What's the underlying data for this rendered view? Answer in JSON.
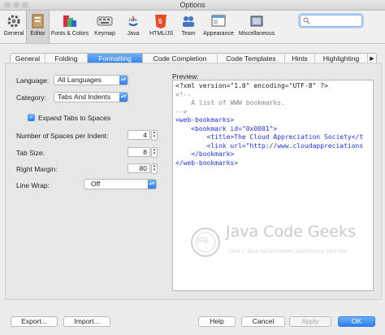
{
  "window": {
    "title": "Options"
  },
  "toolbar": {
    "items": [
      {
        "label": "General",
        "icon": "gear-icon"
      },
      {
        "label": "Editor",
        "icon": "editor-icon"
      },
      {
        "label": "Fonts & Colors",
        "icon": "fonts-colors-icon"
      },
      {
        "label": "Keymap",
        "icon": "keymap-icon"
      },
      {
        "label": "Java",
        "icon": "java-icon"
      },
      {
        "label": "HTML/JS",
        "icon": "html5-icon"
      },
      {
        "label": "Team",
        "icon": "team-icon"
      },
      {
        "label": "Appearance",
        "icon": "appearance-icon"
      },
      {
        "label": "Miscellaneous",
        "icon": "miscellaneous-icon"
      }
    ],
    "selected": "Editor",
    "search": {
      "value": "",
      "placeholder": ""
    }
  },
  "tabs": {
    "items": [
      "General",
      "Folding",
      "Formatting",
      "Code Completion",
      "Code Templates",
      "Hints",
      "Highlighting"
    ],
    "selected": "Formatting"
  },
  "form": {
    "language_label": "Language:",
    "language_value": "All Languages",
    "category_label": "Category:",
    "category_value": "Tabs And Indents",
    "expand_tabs_label": "Expand Tabs to Spaces",
    "expand_tabs_checked": true,
    "spaces_label": "Number of Spaces per Indent:",
    "spaces_value": "4",
    "tab_size_label": "Tab Size:",
    "tab_size_value": "8",
    "right_margin_label": "Right Margin:",
    "right_margin_value": "80",
    "line_wrap_label": "Line Wrap:",
    "line_wrap_value": "Off"
  },
  "preview": {
    "label": "Preview:",
    "lines": [
      "<?xml version=\"1.0\" encoding=\"UTF-8\" ?>",
      "<!--",
      "    A list of WWW bookmarks.",
      "-->",
      "<web-bookmarks>",
      "    <bookmark id=\"0x0001\">",
      "        <title>The Cloud Appreciation Society</t",
      "        <link url=\"http://www.cloudappreciations",
      "    </bookmark>",
      "</web-bookmarks>"
    ]
  },
  "watermark": {
    "logo_text": "jcg",
    "title": "Java Code Geeks",
    "subtitle": "JAVA 2 JAVA DEVELOPERS RESOURCE CENTER"
  },
  "footer": {
    "export_label": "Export...",
    "import_label": "Import...",
    "help_label": "Help",
    "cancel_label": "Cancel",
    "apply_label": "Apply",
    "ok_label": "OK"
  }
}
